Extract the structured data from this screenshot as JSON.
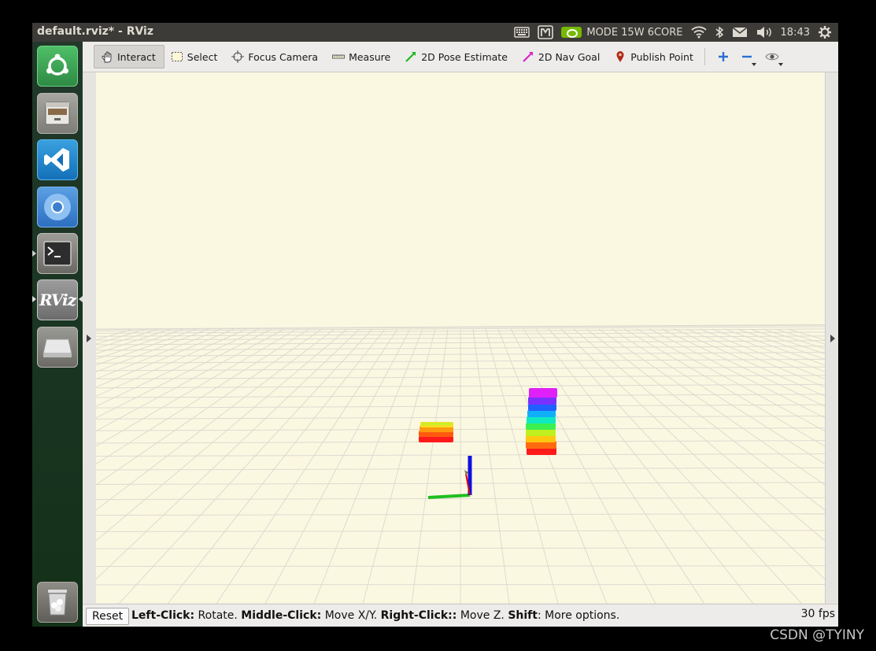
{
  "window": {
    "title": "default.rviz* - RViz"
  },
  "tray": {
    "power_mode": "MODE 15W 6CORE",
    "time": "18:43",
    "icons": [
      "keyboard-icon",
      "mate-icon",
      "nvidia-icon",
      "wifi-icon",
      "bluetooth-icon",
      "mail-icon",
      "volume-icon",
      "gear-icon"
    ]
  },
  "launcher": {
    "items": [
      "ubuntu-icon",
      "files-icon",
      "vscode-icon",
      "chromium-icon",
      "terminal-icon",
      "rviz-icon",
      "drive-icon",
      "trash-icon"
    ],
    "rviz_label": "RViz"
  },
  "toolbar": {
    "tools": [
      {
        "label": "Interact",
        "icon": "hand-icon",
        "active": true
      },
      {
        "label": "Select",
        "icon": "select-box-icon"
      },
      {
        "label": "Focus Camera",
        "icon": "crosshair-icon"
      },
      {
        "label": "Measure",
        "icon": "ruler-icon"
      },
      {
        "label": "2D Pose Estimate",
        "icon": "green-arrow-icon"
      },
      {
        "label": "2D Nav Goal",
        "icon": "magenta-arrow-icon"
      },
      {
        "label": "Publish Point",
        "icon": "map-pin-icon"
      }
    ],
    "extra_icons": [
      "plus-icon",
      "minus-icon",
      "eye-icon"
    ]
  },
  "colors": {
    "viewport_bg": "#fbf8e2",
    "grid": "#dcdad0",
    "axis_x": "#e00000",
    "axis_y": "#1fbf1f",
    "axis_z": "#1010e0"
  },
  "status": {
    "reset_label": "Reset",
    "hint_parts": [
      {
        "b": "Left-Click:",
        "t": " Rotate. "
      },
      {
        "b": "Middle-Click:",
        "t": " Move X/Y. "
      },
      {
        "b": "Right-Click::",
        "t": " Move Z. "
      },
      {
        "b": "Shift",
        "t": ": More options."
      }
    ],
    "fps": "30 fps"
  },
  "watermark": "CSDN @TYINY"
}
